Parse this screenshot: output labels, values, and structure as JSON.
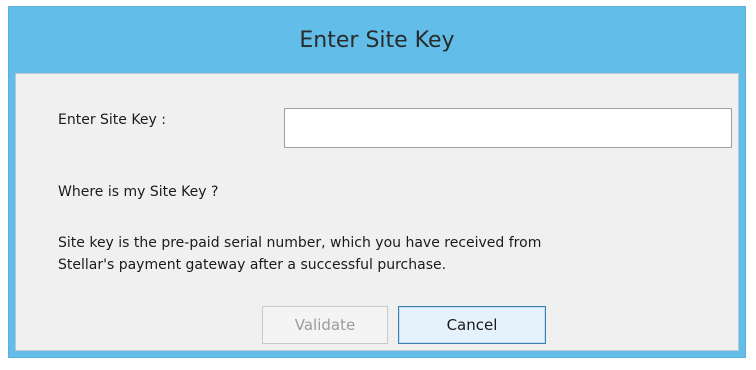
{
  "dialog": {
    "title": "Enter Site Key",
    "key_label": "Enter Site Key :",
    "key_input": {
      "value": "",
      "placeholder": ""
    },
    "where_label": "Where is my Site Key ?",
    "info_line1": "Site key is the pre-paid serial number, which you have received from",
    "info_line2": "Stellar's payment  gateway after a successful purchase.",
    "validate_label": "Validate",
    "cancel_label": "Cancel"
  },
  "colors": {
    "titlebar": "#62bde9",
    "client_background": "#f0f0f0",
    "cancel_border": "#3c7fb1"
  }
}
